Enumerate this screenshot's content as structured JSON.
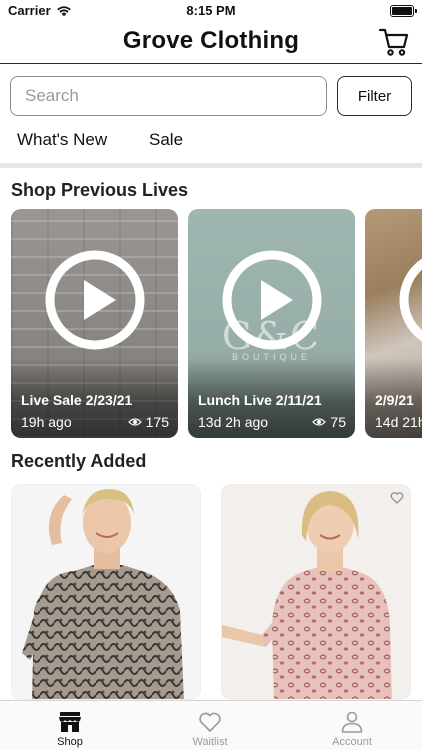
{
  "status_bar": {
    "carrier": "Carrier",
    "time": "8:15 PM",
    "battery_level": 1.0
  },
  "header": {
    "title": "Grove Clothing",
    "cart_icon": "cart-icon"
  },
  "search": {
    "placeholder": "Search",
    "value": ""
  },
  "filter_label": "Filter",
  "tabs": [
    {
      "label": "What's New"
    },
    {
      "label": "Sale"
    }
  ],
  "lives_section": {
    "title": "Shop Previous Lives",
    "cards": [
      {
        "title": "Live Sale 2/23/21",
        "ago": "19h ago",
        "views": "175"
      },
      {
        "title": "Lunch Live 2/11/21",
        "ago": "13d 2h ago",
        "views": "75"
      },
      {
        "title": "2/9/21",
        "ago": "14d 21h",
        "views": ""
      }
    ],
    "watermark_logo_text": "G&C",
    "watermark_sub_text": "BOUTIQUE"
  },
  "recent_section": {
    "title": "Recently Added"
  },
  "tab_bar": {
    "items": [
      {
        "label": "Shop",
        "icon": "storefront-icon",
        "active": true
      },
      {
        "label": "Waitlist",
        "icon": "heart-icon",
        "active": false
      },
      {
        "label": "Account",
        "icon": "person-icon",
        "active": false
      }
    ]
  },
  "colors": {
    "active_tab": "#111111",
    "inactive_tab": "#9a9a9a",
    "divider": "#e6e6e6"
  }
}
